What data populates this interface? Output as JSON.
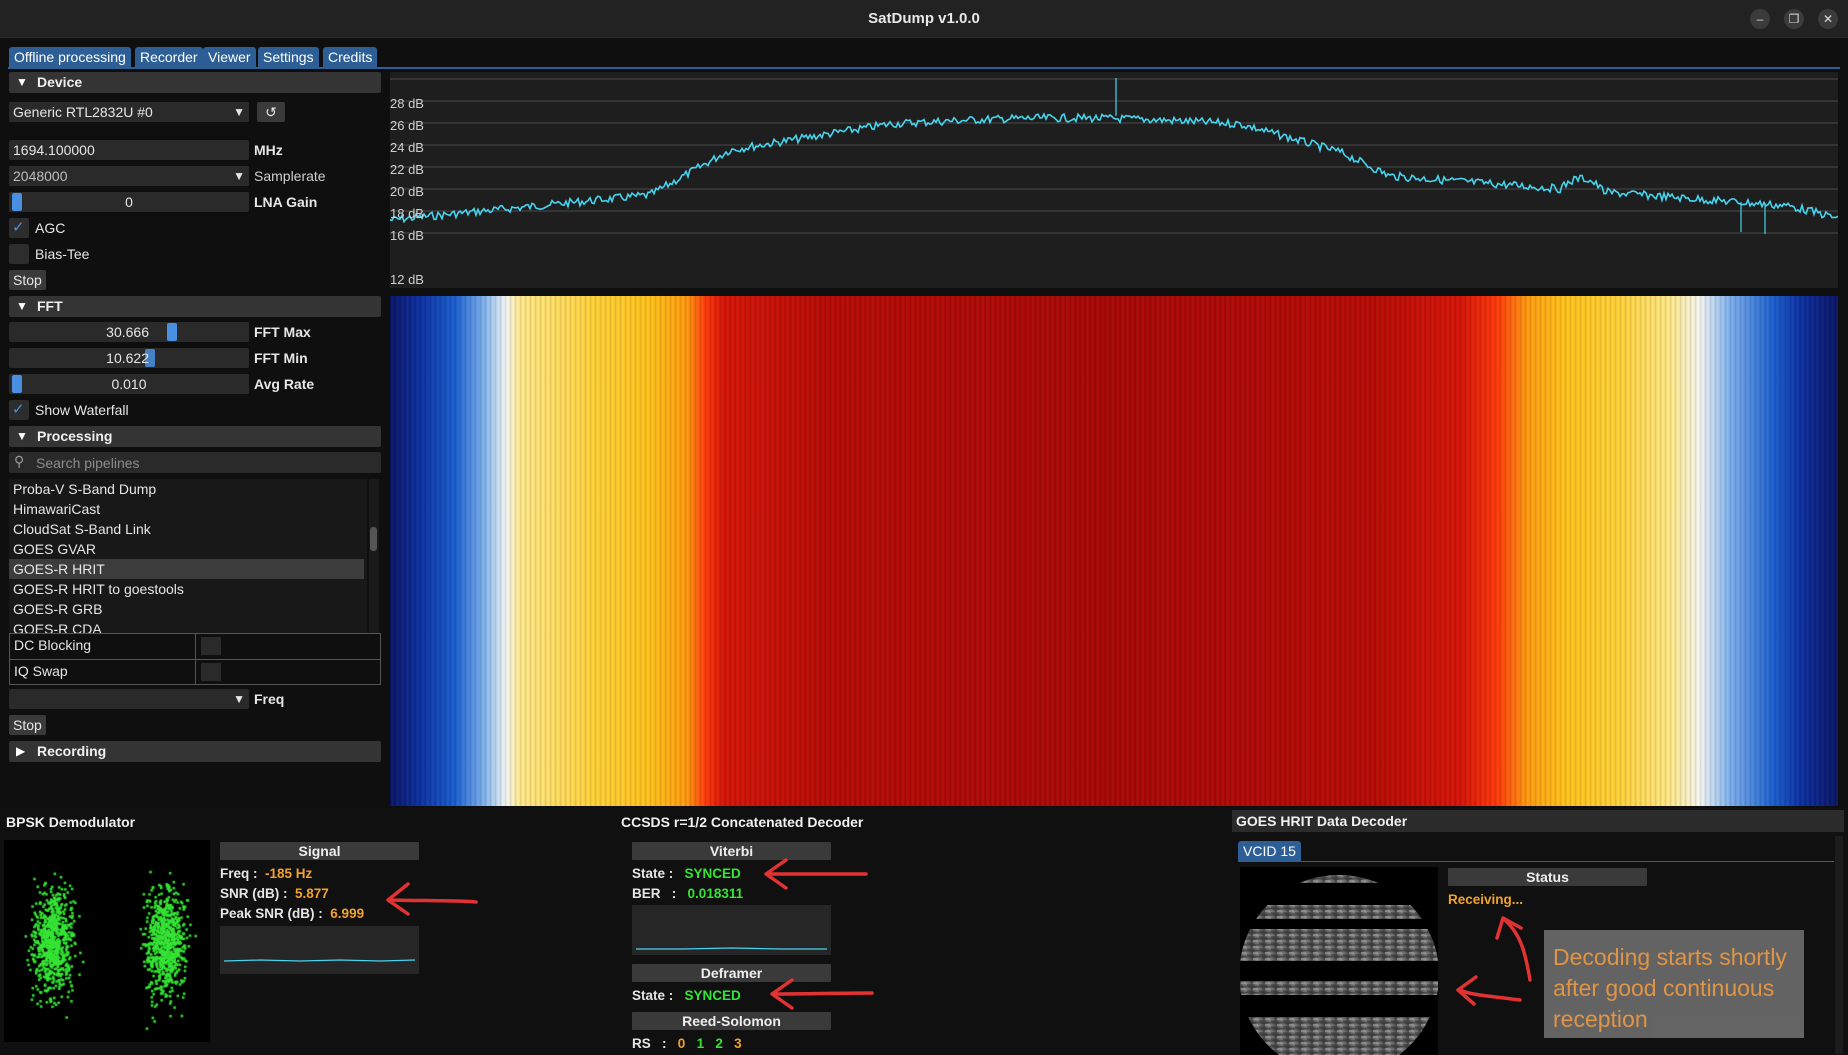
{
  "window": {
    "title": "SatDump v1.0.0"
  },
  "tabs": [
    "Offline processing",
    "Recorder",
    "Viewer",
    "Settings",
    "Credits"
  ],
  "device": {
    "header": "Device",
    "selected_device": "Generic RTL2832U #0",
    "frequency": "1694.100000",
    "frequency_unit": "MHz",
    "samplerate": "2048000",
    "samplerate_label": "Samplerate",
    "lna_gain": "0",
    "lna_gain_fraction": 0.0,
    "lna_label": "LNA Gain",
    "agc_label": "AGC",
    "agc_checked": true,
    "biastee_label": "Bias-Tee",
    "biastee_checked": false,
    "stop_label": "Stop"
  },
  "fft": {
    "header": "FFT",
    "max_value": "30.666",
    "max_label": "FFT Max",
    "min_value": "10.622",
    "min_label": "FFT Min",
    "avg_value": "0.010",
    "avg_label": "Avg Rate",
    "show_waterfall_label": "Show Waterfall",
    "show_waterfall_checked": true
  },
  "processing": {
    "header": "Processing",
    "search_placeholder": "Search pipelines",
    "pipelines": [
      "Proba-V S-Band Dump",
      "HimawariCast",
      "CloudSat S-Band Link",
      "GOES GVAR",
      "GOES-R HRIT",
      "GOES-R HRIT to goestools",
      "GOES-R GRB",
      "GOES-R CDA"
    ],
    "selected_pipeline": "GOES-R HRIT",
    "options": [
      {
        "label": "DC Blocking",
        "checked": false
      },
      {
        "label": "IQ Swap",
        "checked": false
      }
    ],
    "freq_label": "Freq",
    "stop_label": "Stop"
  },
  "recording": {
    "header": "Recording"
  },
  "fft_plot": {
    "y_ticks": [
      "28 dB",
      "26 dB",
      "24 dB",
      "22 dB",
      "20 dB",
      "18 dB",
      "16 dB",
      "12 dB"
    ]
  },
  "bpsk": {
    "title": "BPSK Demodulator",
    "signal_header": "Signal",
    "freq_label": "Freq :",
    "freq_value": "-185 Hz",
    "snr_label": "SNR (dB) :",
    "snr_value": "5.877",
    "peak_label": "Peak SNR (dB) :",
    "peak_value": "6.999"
  },
  "ccsds": {
    "title": "CCSDS r=1/2 Concatenated Decoder",
    "viterbi_header": "Viterbi",
    "state_label": "State :",
    "viterbi_state": "SYNCED",
    "ber_label": "BER",
    "ber_sep": ":",
    "ber_value": "0.018311",
    "deframer_header": "Deframer",
    "deframer_state": "SYNCED",
    "rs_header": "Reed-Solomon",
    "rs_label": "RS",
    "rs_sep": ":",
    "rs_values": [
      "0",
      "1",
      "2",
      "3"
    ]
  },
  "goes": {
    "title": "GOES HRIT Data Decoder",
    "vcid_tab": "VCID 15",
    "status_header": "Status",
    "status_value": "Receiving..."
  },
  "annotation": {
    "text_lines": [
      "Decoding starts shortly",
      "after good continuous",
      "reception"
    ]
  },
  "colors": {
    "accent": "#2d5f96",
    "spectrum": "#46d4ee",
    "synced": "#35e535",
    "value_orange": "#f2a22c",
    "annotation_arrow": "#e23232",
    "annotation_box": "#6b6b6b",
    "annotation_text": "#f2a04a"
  },
  "icons": {
    "minimize": "minimize-icon",
    "restore": "restore-icon",
    "close": "close-icon",
    "refresh": "refresh-icon",
    "search": "search-icon"
  }
}
